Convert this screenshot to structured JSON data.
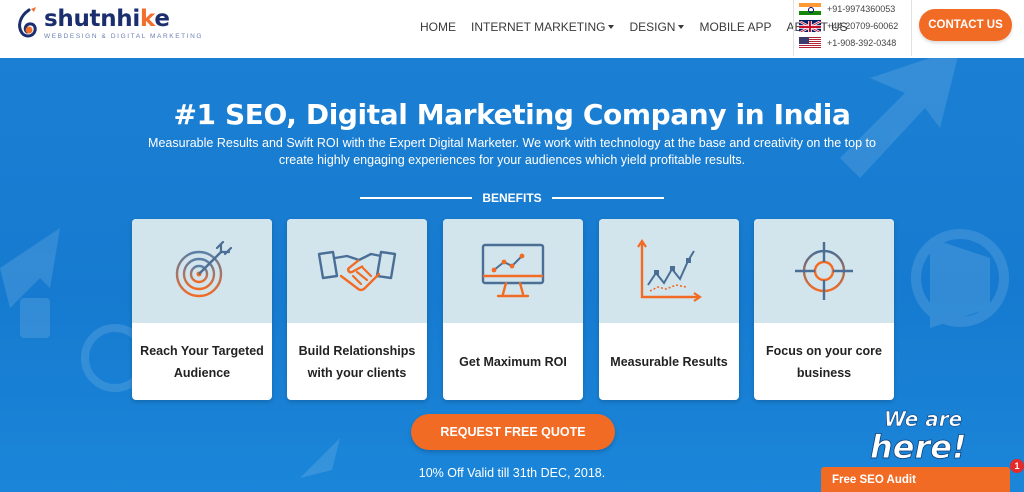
{
  "brand": {
    "name_part1": "sh",
    "name_part2": "utnhi",
    "name_part3": "k",
    "name_part4": "e",
    "tagline": "WEBDESIGN & DIGITAL MARKETING"
  },
  "nav": {
    "items": [
      {
        "label": "HOME"
      },
      {
        "label": "INTERNET MARKETING"
      },
      {
        "label": "DESIGN"
      },
      {
        "label": "MOBILE APP"
      },
      {
        "label": "ABOUT US"
      }
    ]
  },
  "phones": [
    {
      "number": "+91-9974360053",
      "flag": "india-flag"
    },
    {
      "number": "+44-20709-60062",
      "flag": "uk-flag"
    },
    {
      "number": "+1-908-392-0348",
      "flag": "us-flag"
    }
  ],
  "contact_button": "CONTACT US",
  "hero": {
    "headline": "#1 SEO, Digital Marketing Company in India",
    "subtext": "Measurable Results and Swift ROI with the Expert Digital Marketer. We work with technology at the base and creativity on the top to create highly engaging experiences for your audiences which yield profitable results.",
    "benefits_label": "BENEFITS"
  },
  "cards": [
    {
      "label": "Reach Your Targeted Audience",
      "icon": "target-dart-icon"
    },
    {
      "label": "Build Relationships with your clients",
      "icon": "handshake-icon"
    },
    {
      "label": "Get Maximum ROI",
      "icon": "monitor-chart-icon"
    },
    {
      "label": "Measurable Results",
      "icon": "line-graph-icon"
    },
    {
      "label": "Focus on your core business",
      "icon": "crosshair-icon"
    }
  ],
  "quote_button": "REQUEST FREE QUOTE",
  "offer": "10% Off Valid till 31th DEC, 2018.",
  "chat": {
    "we_are": "We are",
    "here": "here!",
    "tab_label": "Free SEO Audit",
    "badge_count": "1"
  },
  "colors": {
    "accent": "#f26b24",
    "hero_blue": "#1b7fd3",
    "brand_navy": "#1b2f6e"
  }
}
